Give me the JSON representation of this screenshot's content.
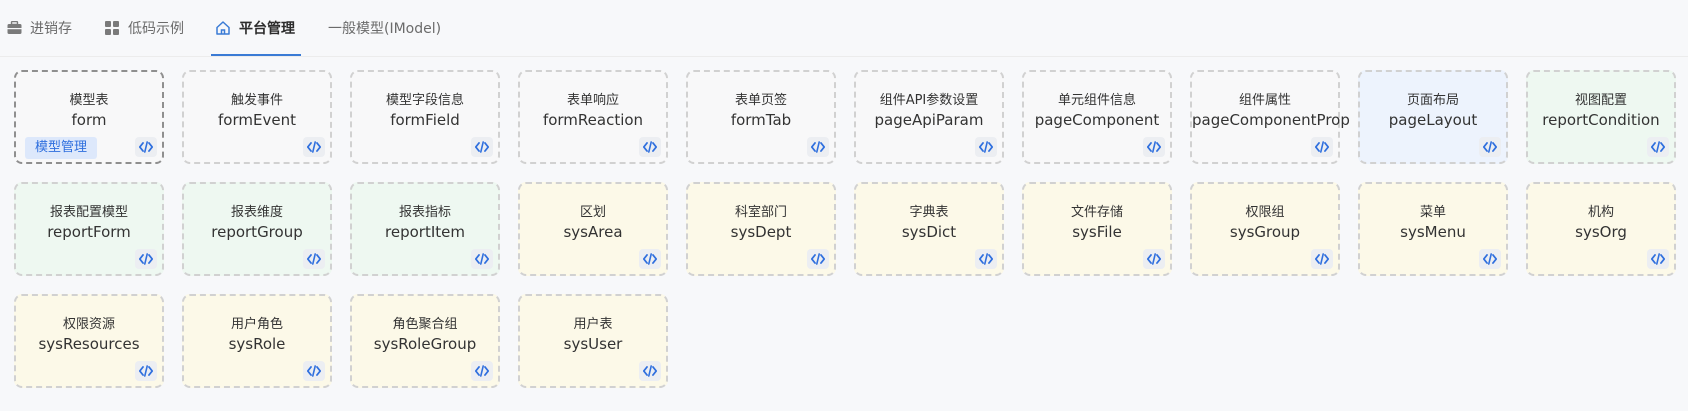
{
  "tabs": [
    {
      "label": "进销存",
      "icon": "briefcase-icon",
      "active": false
    },
    {
      "label": "低码示例",
      "icon": "grid-icon",
      "active": false
    },
    {
      "label": "平台管理",
      "icon": "home-icon",
      "active": true
    },
    {
      "label": "一般模型(IModel)",
      "icon": "",
      "active": false
    }
  ],
  "colors": {
    "accent": "#3a7bd5",
    "card_gray": "#f8f8f9",
    "card_blue": "#edf3fd",
    "card_green": "#eef8f1",
    "card_yellow": "#fcf9e8",
    "tag_bg": "#dde8fb"
  },
  "cards": [
    {
      "cn": "模型表",
      "en": "form",
      "color": "gray",
      "tag": "模型管理",
      "selected": true
    },
    {
      "cn": "触发事件",
      "en": "formEvent",
      "color": "gray"
    },
    {
      "cn": "模型字段信息",
      "en": "formField",
      "color": "gray"
    },
    {
      "cn": "表单响应",
      "en": "formReaction",
      "color": "gray"
    },
    {
      "cn": "表单页签",
      "en": "formTab",
      "color": "gray"
    },
    {
      "cn": "组件API参数设置",
      "en": "pageApiParam",
      "color": "gray"
    },
    {
      "cn": "单元组件信息",
      "en": "pageComponent",
      "color": "gray"
    },
    {
      "cn": "组件属性",
      "en": "pageComponentProp",
      "color": "gray"
    },
    {
      "cn": "页面布局",
      "en": "pageLayout",
      "color": "blue"
    },
    {
      "cn": "视图配置",
      "en": "reportCondition",
      "color": "green"
    },
    {
      "cn": "报表配置模型",
      "en": "reportForm",
      "color": "green"
    },
    {
      "cn": "报表维度",
      "en": "reportGroup",
      "color": "green"
    },
    {
      "cn": "报表指标",
      "en": "reportItem",
      "color": "green"
    },
    {
      "cn": "区划",
      "en": "sysArea",
      "color": "yellow"
    },
    {
      "cn": "科室部门",
      "en": "sysDept",
      "color": "yellow"
    },
    {
      "cn": "字典表",
      "en": "sysDict",
      "color": "yellow"
    },
    {
      "cn": "文件存储",
      "en": "sysFile",
      "color": "yellow"
    },
    {
      "cn": "权限组",
      "en": "sysGroup",
      "color": "yellow"
    },
    {
      "cn": "菜单",
      "en": "sysMenu",
      "color": "yellow"
    },
    {
      "cn": "机构",
      "en": "sysOrg",
      "color": "yellow"
    },
    {
      "cn": "权限资源",
      "en": "sysResources",
      "color": "yellow"
    },
    {
      "cn": "用户角色",
      "en": "sysRole",
      "color": "yellow"
    },
    {
      "cn": "角色聚合组",
      "en": "sysRoleGroup",
      "color": "yellow"
    },
    {
      "cn": "用户表",
      "en": "sysUser",
      "color": "yellow"
    }
  ]
}
